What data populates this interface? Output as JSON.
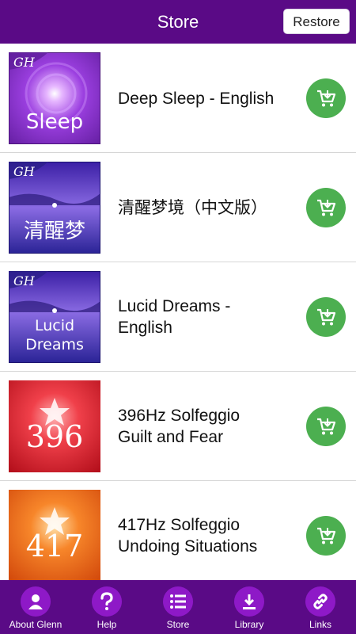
{
  "header": {
    "title": "Store",
    "restore_label": "Restore"
  },
  "items": [
    {
      "name_line1": "Deep Sleep - English",
      "name_line2": "",
      "thumb_text": "Sleep",
      "logo": "GH",
      "thumb_icon": "sleep-album-art"
    },
    {
      "name_line1": "清醒梦境（中文版）",
      "name_line2": "",
      "thumb_text": "清醒梦",
      "logo": "GH",
      "thumb_icon": "lucid-dreams-chinese-album-art"
    },
    {
      "name_line1": "Lucid Dreams -",
      "name_line2": "English",
      "thumb_text_1": "Lucid",
      "thumb_text_2": "Dreams",
      "logo": "GH",
      "thumb_icon": "lucid-dreams-album-art"
    },
    {
      "name_line1": "396Hz Solfeggio",
      "name_line2": "Guilt and Fear",
      "thumb_text": "396",
      "thumb_icon": "solfeggio-396-album-art"
    },
    {
      "name_line1": "417Hz Solfeggio",
      "name_line2": "Undoing Situations",
      "thumb_text": "417",
      "thumb_icon": "solfeggio-417-album-art"
    }
  ],
  "tabs": [
    {
      "label": "About Glenn",
      "icon": "person-icon"
    },
    {
      "label": "Help",
      "icon": "question-icon"
    },
    {
      "label": "Store",
      "icon": "list-icon"
    },
    {
      "label": "Library",
      "icon": "download-icon"
    },
    {
      "label": "Links",
      "icon": "link-icon"
    }
  ],
  "colors": {
    "header": "#5a0a86",
    "tab_circle": "#8e19c7",
    "buy_button": "#4caf50"
  }
}
